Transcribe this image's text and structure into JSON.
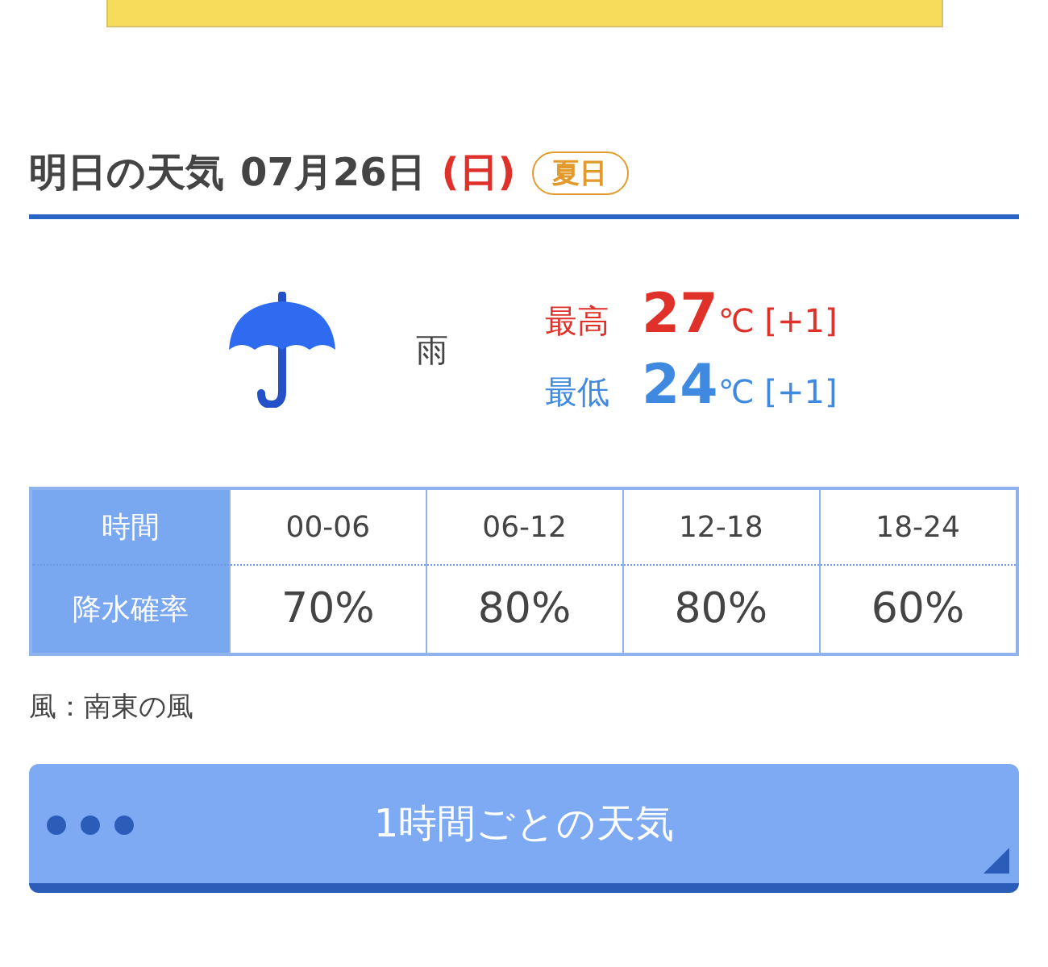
{
  "header": {
    "title": "明日の天気",
    "date": "07月26日",
    "weekday": "(日)",
    "badge": "夏日"
  },
  "forecast": {
    "weather": "雨",
    "temps": [
      {
        "kind": "high",
        "label": "最高",
        "value": "27",
        "unit": "℃",
        "diff": "[+1]"
      },
      {
        "kind": "low",
        "label": "最低",
        "value": "24",
        "unit": "℃",
        "diff": "[+1]"
      }
    ]
  },
  "table": {
    "rows": [
      {
        "kind": "time",
        "label": "時間",
        "cells": [
          "00-06",
          "06-12",
          "12-18",
          "18-24"
        ]
      },
      {
        "kind": "rain",
        "label": "降水確率",
        "cells": [
          "70%",
          "80%",
          "80%",
          "60%"
        ]
      }
    ]
  },
  "wind": "風：南東の風",
  "button": {
    "label": "1時間ごとの天気"
  }
}
